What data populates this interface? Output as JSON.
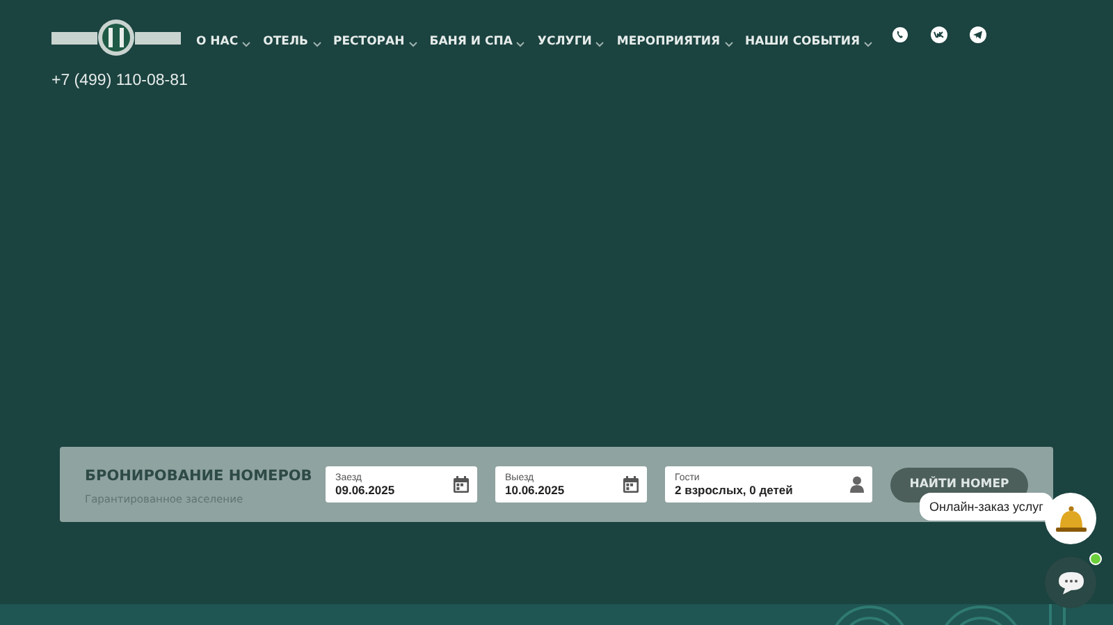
{
  "nav": [
    {
      "label": "О НАС",
      "dropdown": true
    },
    {
      "label": "ОТЕЛЬ",
      "dropdown": true
    },
    {
      "label": "РЕСТОРАН",
      "dropdown": true
    },
    {
      "label": "БАНЯ И СПА",
      "dropdown": true
    },
    {
      "label": "УСЛУГИ",
      "dropdown": true
    },
    {
      "label": "МЕРОПРИЯТИЯ",
      "dropdown": true
    },
    {
      "label": "НАШИ СОБЫТИЯ",
      "dropdown": true
    }
  ],
  "social": [
    {
      "kind": "whatsapp"
    },
    {
      "kind": "vk"
    },
    {
      "kind": "telegram"
    }
  ],
  "phone": "+7 (499) 110-08-81",
  "booking": {
    "title": "БРОНИРОВАНИЕ НОМЕРОВ",
    "subtitle": "Гарантированное заселение",
    "fields": [
      {
        "label": "Заезд",
        "value": "09.06.2025",
        "kind": "date"
      },
      {
        "label": "Выезд",
        "value": "10.06.2025",
        "kind": "date"
      },
      {
        "label": "Гости",
        "value": "2 взрослых, 0 детей",
        "kind": "guests"
      }
    ],
    "button": "НАЙТИ НОМЕР"
  },
  "widget": {
    "tooltip": "Онлайн-заказ услуг",
    "online": true
  }
}
